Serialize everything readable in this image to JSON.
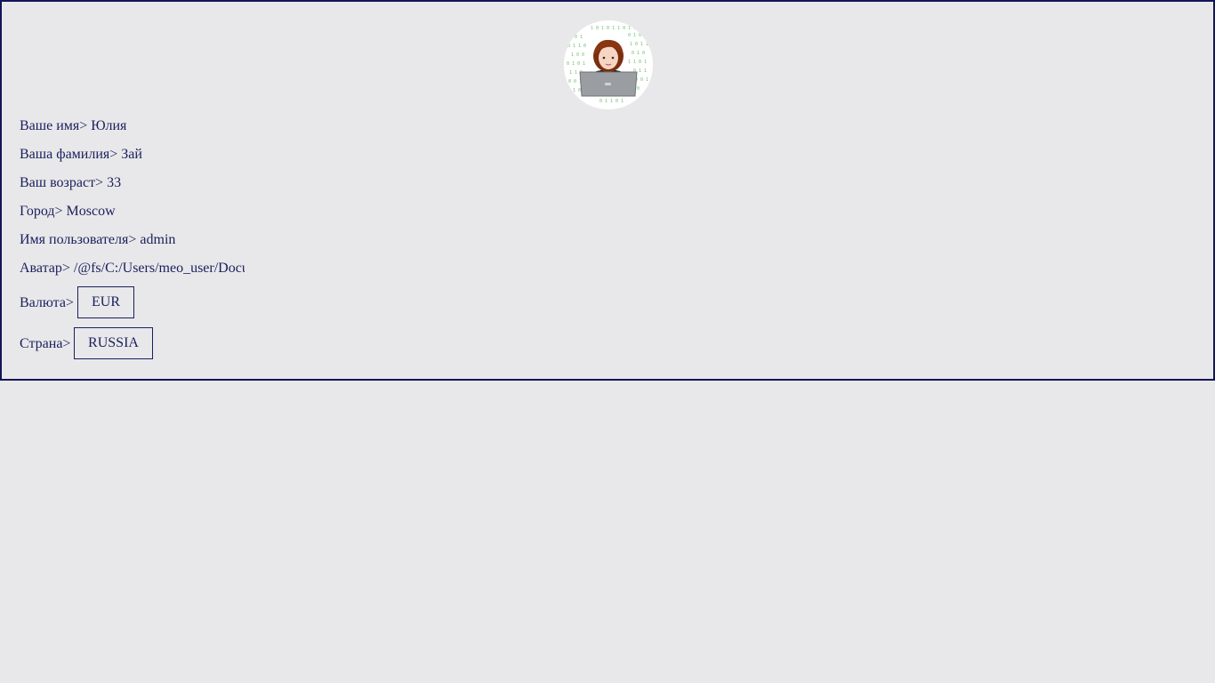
{
  "profile": {
    "avatar_alt": "woman-with-laptop-avatar",
    "fields": [
      {
        "label": "Ваше имя>",
        "value": "Юлия"
      },
      {
        "label": "Ваша фамилия>",
        "value": "Зай"
      },
      {
        "label": "Ваш возраст>",
        "value": "33"
      },
      {
        "label": "Город>",
        "value": "Moscow"
      },
      {
        "label": "Имя пользователя>",
        "value": "admin"
      },
      {
        "label": "Аватар>",
        "value": "/@fs/C:/Users/meo_user/Documents"
      }
    ],
    "currency": {
      "label": "Валюта>",
      "value": "EUR"
    },
    "country": {
      "label": "Страна>",
      "value": "RUSSIA"
    }
  },
  "colors": {
    "text": "#1a1f5c",
    "border": "#14145a",
    "background": "#e8e8ea"
  }
}
